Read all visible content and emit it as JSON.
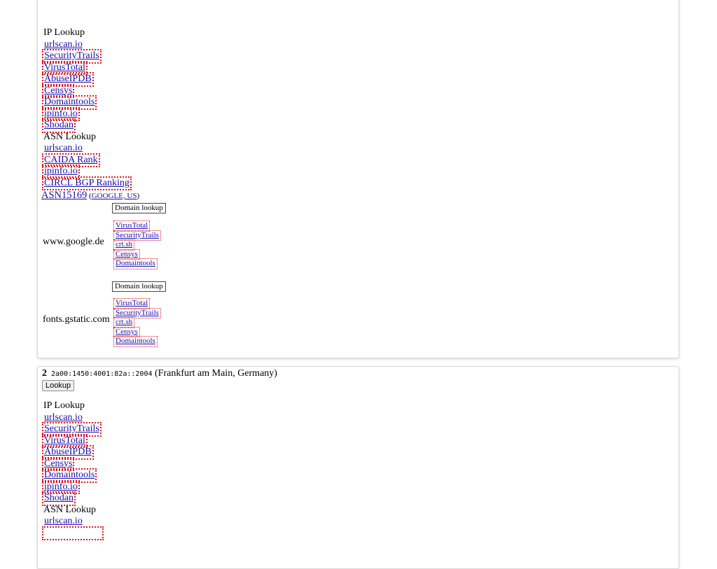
{
  "card1": {
    "ip_lookup_header": "IP Lookup",
    "ip_links": [
      "urlscan.io",
      "SecurityTrails",
      "VirusTotal",
      "AbuseIPDB",
      "Censys",
      "Domaintools",
      "ipinfo.io",
      "Shodan"
    ],
    "asn_lookup_header": "ASN Lookup",
    "asn_links": [
      "urlscan.io",
      "CAIDA Rank",
      "ipinfo.io",
      "CIRCL BGP Ranking"
    ],
    "asn": {
      "number": "ASN15169",
      "paren_open": " (",
      "org": "GOOGLE, US",
      "paren_close": ")"
    },
    "domains": [
      {
        "name": "www.google.de",
        "button_label": "Domain lookup",
        "links": [
          "VirusTotal",
          "SecurityTrails",
          "crt.sh",
          "Censys",
          "Domaintools"
        ]
      },
      {
        "name": "fonts.gstatic.com",
        "button_label": "Domain lookup",
        "links": [
          "VirusTotal",
          "SecurityTrails",
          "crt.sh",
          "Censys",
          "Domaintools"
        ]
      }
    ]
  },
  "card2": {
    "index": "2",
    "ip": "2a00:1450:4001:82a::2004",
    "location": " (Frankfurt am Main, Germany)",
    "lookup_button": "Lookup",
    "ip_lookup_header": "IP Lookup",
    "ip_links": [
      "urlscan.io",
      "SecurityTrails",
      "VirusTotal",
      "AbuseIPDB",
      "Censys",
      "Domaintools",
      "ipinfo.io",
      "Shodan"
    ],
    "asn_lookup_header": "ASN Lookup",
    "asn_links": [
      "urlscan.io",
      ""
    ]
  },
  "colors": {
    "link": "#1a0dab",
    "dotted_outline": "#e4141b",
    "card_border": "#d9d9d9"
  }
}
